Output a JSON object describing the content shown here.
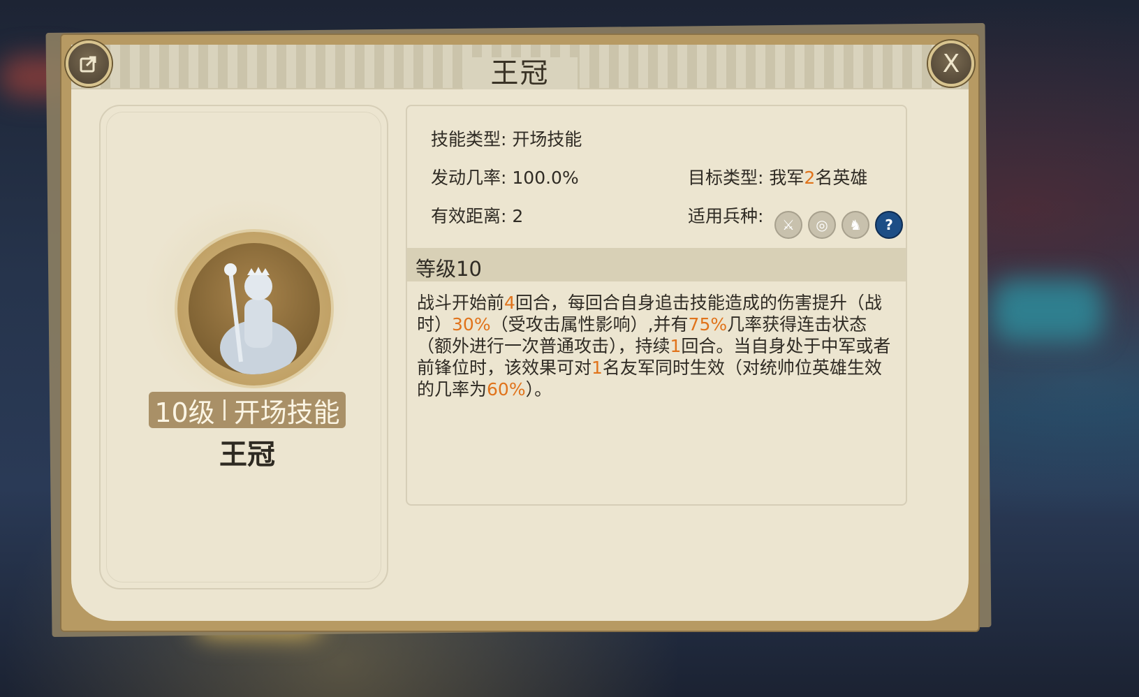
{
  "dialog": {
    "title": "王冠",
    "share_icon": "share-icon",
    "close_label": "X"
  },
  "left": {
    "level_text": "10级",
    "skill_type_text": "开场技能",
    "skill_name": "王冠",
    "portrait_icon": "queen-statue-portrait"
  },
  "info": {
    "skill_type_label": "技能类型:",
    "skill_type_value": "开场技能",
    "trigger_label": "发动几率:",
    "trigger_value": "100.0%",
    "target_label": "目标类型:",
    "target_prefix": "我军",
    "target_num": "2",
    "target_suffix": "名英雄",
    "range_label": "有效距离:",
    "range_value": "2",
    "troop_label": "适用兵种:",
    "troops": [
      "sword-icon",
      "target-icon",
      "horse-icon",
      "help-icon"
    ],
    "help_symbol": "?"
  },
  "grade": "等级10",
  "description": {
    "p1": "战斗开始前",
    "n1": "4",
    "p2": "回合，每回合自身追击技能造成的伤害提升（战时）",
    "n2": "30%",
    "p3": "（受攻击属性影响）,并有",
    "n3": "75%",
    "p4": "几率获得连击状态（额外进行一次普通攻击），持续",
    "n4": "1",
    "p5": "回合。当自身处于中军或者前锋位时，该效果可对",
    "n5": "1",
    "p6": "名友军同时生效（对统帅位英雄生效的几率为",
    "n6": "60%",
    "p7": "）。"
  },
  "colors": {
    "highlight": "#e0731b",
    "frame": "#b79a63",
    "paper": "#ece5d0"
  }
}
